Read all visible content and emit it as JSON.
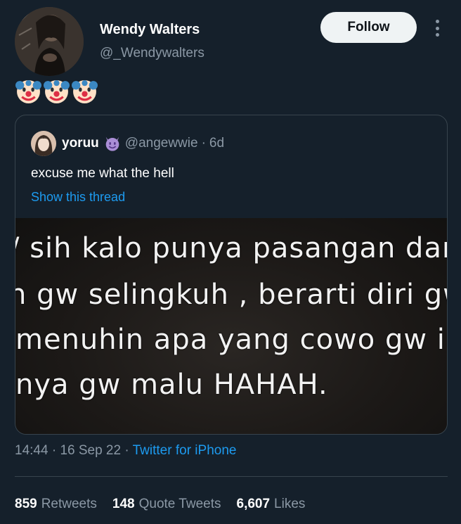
{
  "author": {
    "display_name": "Wendy Walters",
    "handle": "@_Wendywalters"
  },
  "follow_button": {
    "label": "Follow"
  },
  "more_icon": "more-vertical-icon",
  "tweet_text_emojis": [
    "clown-face-icon",
    "clown-face-icon",
    "clown-face-icon"
  ],
  "quoted_tweet": {
    "name": "yoruu",
    "name_emoji": "smiling-devil-icon",
    "handle": "@angewwie",
    "separator": "·",
    "age": "6d",
    "text": "excuse me what the hell",
    "show_thread": "Show this thread",
    "media_lines": [
      "/ sih kalo punya pasangan dar",
      "n gw selingkuh , berarti diri gw",
      "menuhin apa yang cowo gw ir",
      "nya gw malu HAHAH."
    ]
  },
  "meta": {
    "time": "14:44",
    "separator": "·",
    "date": "16 Sep 22",
    "source": "Twitter for iPhone"
  },
  "stats": {
    "retweets_count": "859",
    "retweets_label": "Retweets",
    "quotes_count": "148",
    "quotes_label": "Quote Tweets",
    "likes_count": "6,607",
    "likes_label": "Likes"
  },
  "colors": {
    "background": "#15202b",
    "secondary_text": "#8b98a5",
    "link": "#1d9bf0",
    "border": "#38444d",
    "follow_bg": "#eff3f4"
  }
}
